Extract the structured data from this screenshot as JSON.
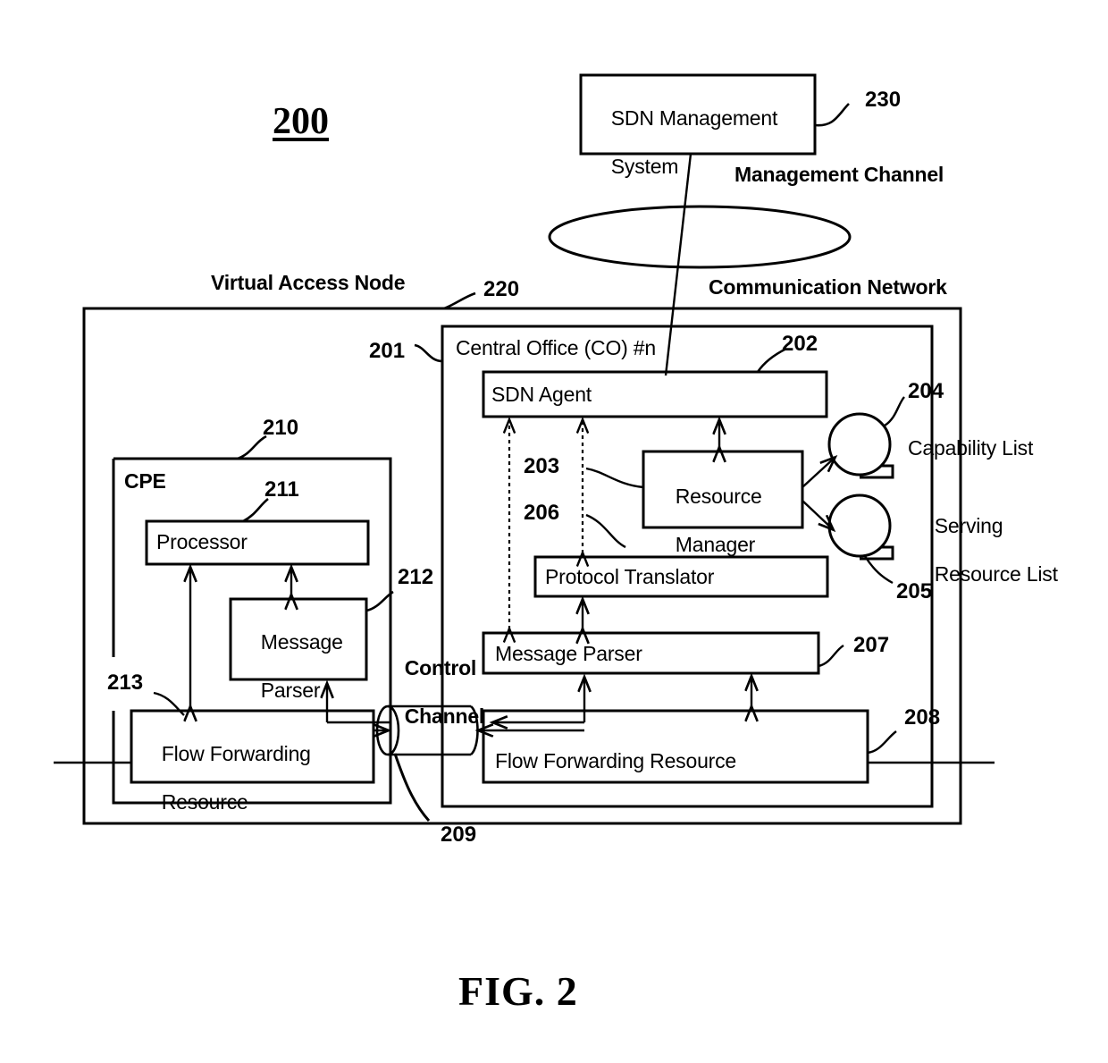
{
  "figure": {
    "id_label": "200",
    "caption": "FIG. 2"
  },
  "annotations": {
    "virtual_access_node": "Virtual Access Node",
    "virtual_access_node_ref": "220",
    "communication_network": "Communication Network",
    "management_channel": "Management Channel",
    "control_channel_line1": "Control",
    "control_channel_line2": "Channel",
    "control_channel_ref": "209",
    "capability_list": "Capability List",
    "capability_list_ref": "204",
    "serving_resource_list_line1": "Serving",
    "serving_resource_list_line2": "Resource List",
    "serving_resource_list_ref": "205"
  },
  "blocks": {
    "sdn_management_system": {
      "line1": "SDN Management",
      "line2": "System",
      "ref": "230"
    },
    "central_office": {
      "title": "Central Office (CO) #n",
      "ref": "201"
    },
    "sdn_agent": {
      "label": "SDN Agent",
      "ref": "202"
    },
    "resource_manager": {
      "line1": "Resource",
      "line2": "Manager",
      "ref": "203"
    },
    "protocol_translator": {
      "label": "Protocol Translator",
      "ref": "206"
    },
    "co_message_parser": {
      "label": "Message Parser",
      "ref": "207"
    },
    "co_flow_forwarding_resource": {
      "label": "Flow Forwarding Resource",
      "ref": "208"
    },
    "cpe": {
      "label": "CPE",
      "ref": "210"
    },
    "processor": {
      "label": "Processor",
      "ref": "211"
    },
    "cpe_message_parser": {
      "line1": "Message",
      "line2": "Parser",
      "ref": "212"
    },
    "cpe_flow_forwarding_resource": {
      "line1": "Flow Forwarding",
      "line2": "Resource",
      "ref": "213"
    }
  },
  "colors": {
    "stroke": "#000000",
    "background": "#ffffff"
  }
}
